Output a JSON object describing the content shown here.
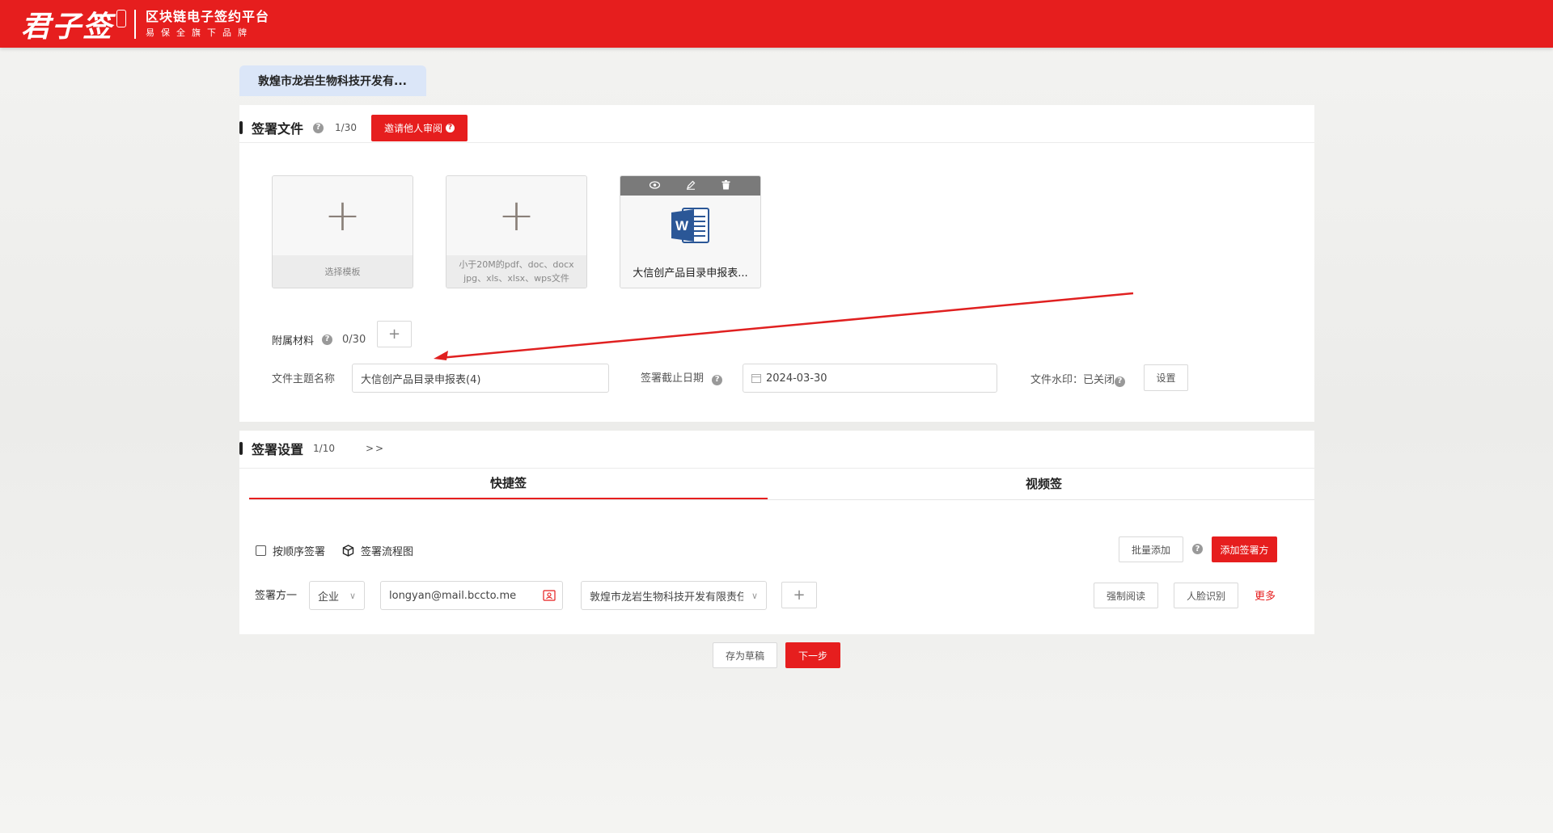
{
  "header": {
    "logo_main": "君子签",
    "platform_name": "区块链电子签约平台",
    "slogan": "易保全旗下品牌"
  },
  "company_tab": "敦煌市龙岩生物科技开发有...",
  "sign_files": {
    "title": "签署文件",
    "count": "1/30",
    "invite_review_label": "邀请他人审阅",
    "select_template_label": "选择模板",
    "upload_hint_line1": "小于20M的pdf、doc、docx",
    "upload_hint_line2": "jpg、xls、xlsx、wps文件",
    "file_name": "大信创产品目录申报表...",
    "attach_label": "附属材料",
    "attach_count": "0/30",
    "subject_label": "文件主题名称",
    "subject_value": "大信创产品目录申报表(4)",
    "deadline_label": "签署截止日期",
    "deadline_value": "2024-03-30",
    "watermark_label": "文件水印：已关闭",
    "watermark_setting": "设置"
  },
  "sign_settings": {
    "title": "签署设置",
    "count": "1/10",
    "arrows": ">>",
    "tabs": [
      "快捷签",
      "视频签"
    ],
    "sequential_label": "按顺序签署",
    "flowchart_label": "签署流程图",
    "batch_add_label": "批量添加",
    "add_signer_label": "添加签署方",
    "signer_label": "签署方一",
    "signer_type": "企业",
    "signer_email": "longyan@mail.bccto.me",
    "signer_company": "敦煌市龙岩生物科技开发有限责任",
    "force_read_label": "强制阅读",
    "face_recognition_label": "人脸识别",
    "more_label": "更多"
  },
  "footer": {
    "save_draft_label": "存为草稿",
    "next_label": "下一步"
  },
  "colors": {
    "brand_red": "#e61e1e",
    "tab_bg": "#dbe6f8",
    "word_blue": "#2b5797"
  },
  "icons": [
    "eye-icon",
    "edit-icon",
    "trash-icon",
    "word-icon",
    "calendar-icon",
    "contact-card-icon",
    "cube-icon",
    "help-icon",
    "chevron-down-icon"
  ]
}
